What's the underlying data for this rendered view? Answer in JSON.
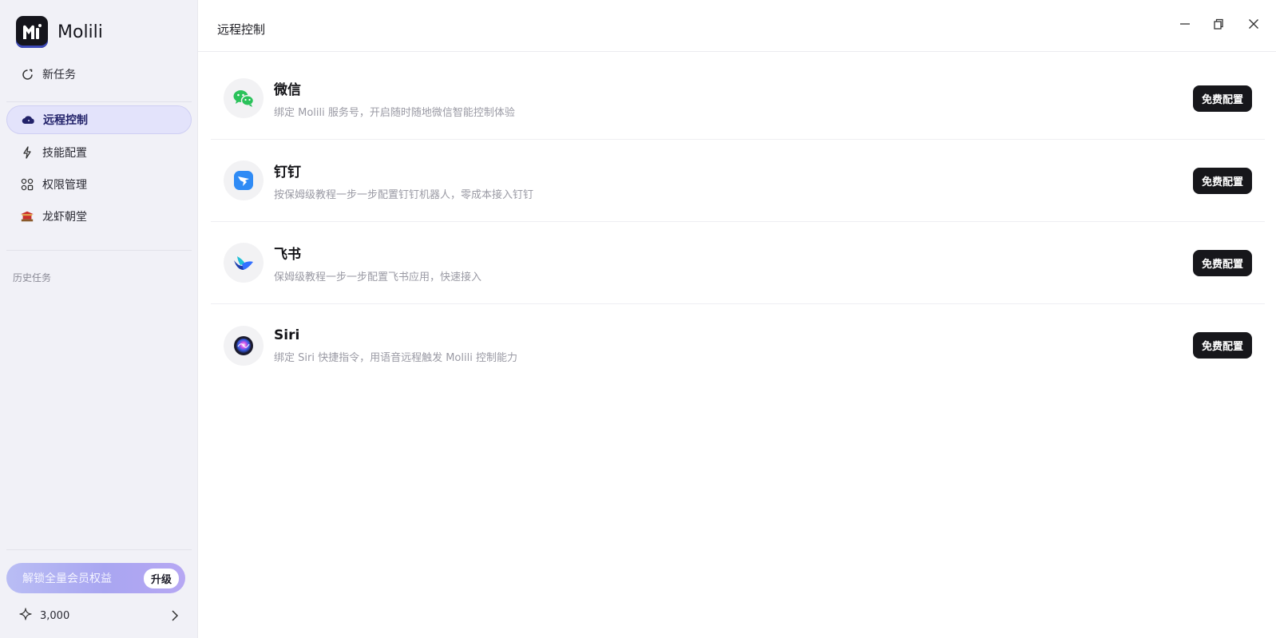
{
  "app": {
    "name": "Molili",
    "logo_icon": "molili-logo-icon"
  },
  "sidebar": {
    "items": [
      {
        "label": "新任务",
        "icon": "new-task-icon"
      },
      {
        "label": "远程控制",
        "icon": "cloud-icon",
        "active": true
      },
      {
        "label": "技能配置",
        "icon": "skill-icon"
      },
      {
        "label": "权限管理",
        "icon": "permission-grid-icon"
      },
      {
        "label": "龙虾朝堂",
        "icon": "palace-icon"
      }
    ],
    "history_label": "历史任务",
    "upgrade": {
      "text": "解锁全量会员权益",
      "button": "升级"
    },
    "credits": {
      "amount": "3,000",
      "icon": "sparkle-icon"
    }
  },
  "main": {
    "title": "远程控制",
    "window_controls": [
      "minimize-icon",
      "restore-icon",
      "close-icon"
    ],
    "integrations": [
      {
        "name": "微信",
        "desc": "绑定 Molili 服务号，开启随时随地微信智能控制体验",
        "button": "免费配置",
        "icon": "wechat-icon"
      },
      {
        "name": "钉钉",
        "desc": "按保姆级教程一步一步配置钉钉机器人，零成本接入钉钉",
        "button": "免费配置",
        "icon": "dingtalk-icon"
      },
      {
        "name": "飞书",
        "desc": "保姆级教程一步一步配置飞书应用，快速接入",
        "button": "免费配置",
        "icon": "feishu-icon"
      },
      {
        "name": "Siri",
        "desc": "绑定 Siri 快捷指令，用语音远程触发 Molili 控制能力",
        "button": "免费配置",
        "icon": "siri-icon"
      }
    ]
  },
  "colors": {
    "accent": "#e3e3fb",
    "button_dark": "#17171b",
    "sidebar_bg": "#f1f1f7"
  }
}
